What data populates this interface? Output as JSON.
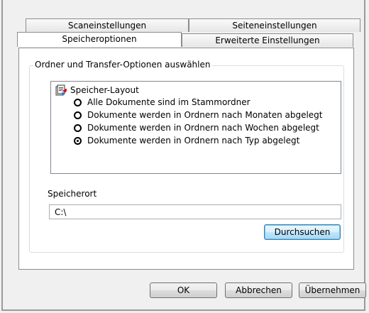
{
  "tabs": {
    "row_back": [
      "Scaneinstellungen",
      "Seiteneinstellungen"
    ],
    "row_front": [
      "Speicheroptionen",
      "Erweiterte Einstellungen"
    ]
  },
  "storage_group": {
    "legend": "Ordner und Transfer-Optionen auswählen",
    "layout_title": "Speicher-Layout",
    "options": [
      {
        "label": "Alle Dokumente sind im Stammordner",
        "selected": false
      },
      {
        "label": "Dokumente werden in Ordnern nach Monaten abgelegt",
        "selected": false
      },
      {
        "label": "Dokumente werden in Ordnern nach Wochen abgelegt",
        "selected": false
      },
      {
        "label": "Dokumente werden in Ordnern nach Typ abgelegt",
        "selected": true
      }
    ],
    "location_label": "Speicherort",
    "location_value": "C:\\",
    "browse_label": "Durchsuchen"
  },
  "footer": {
    "ok_label": "OK",
    "cancel_label": "Abbrechen",
    "apply_label": "Übernehmen"
  },
  "icons": {
    "layout": "storage-layout-icon"
  }
}
